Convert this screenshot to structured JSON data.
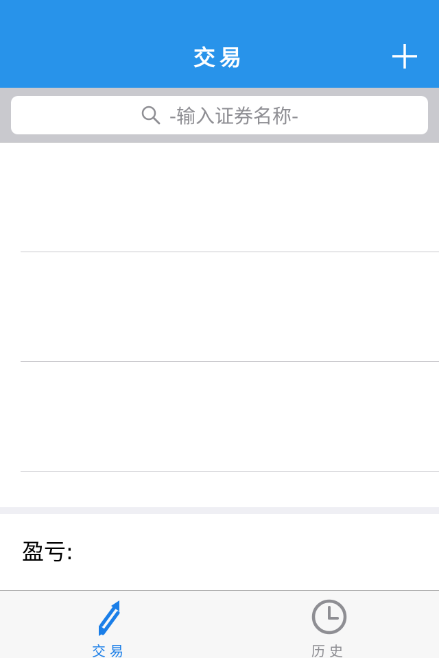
{
  "nav": {
    "title": "交易",
    "add_icon": "plus-icon",
    "background_color": "#2893ea"
  },
  "search": {
    "placeholder": "-输入证券名称-",
    "icon": "search-icon"
  },
  "list": {
    "rows": [
      "",
      "",
      ""
    ]
  },
  "profit": {
    "label": "盈亏:",
    "value": ""
  },
  "tabs": [
    {
      "label": "交易",
      "icon": "trade-arrows-icon",
      "active": true,
      "color": "#1a7ee8"
    },
    {
      "label": "历史",
      "icon": "clock-icon",
      "active": false,
      "color": "#8e8e93"
    }
  ]
}
